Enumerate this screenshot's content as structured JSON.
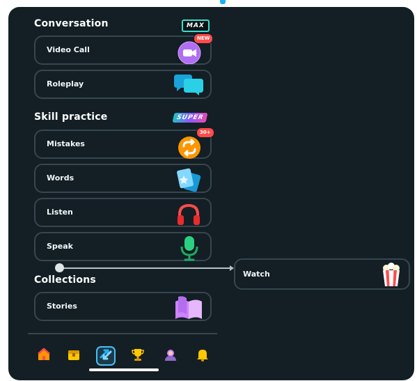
{
  "sections": {
    "conversation": {
      "title": "Conversation",
      "badge": "MAX",
      "items": [
        {
          "label": "Video Call",
          "tag": "NEW",
          "icon": "video-camera-icon"
        },
        {
          "label": "Roleplay",
          "icon": "chat-bubbles-icon"
        }
      ]
    },
    "skill_practice": {
      "title": "Skill practice",
      "badge": "SUPER",
      "items": [
        {
          "label": "Mistakes",
          "tag": "30+",
          "icon": "repeat-arrows-icon"
        },
        {
          "label": "Words",
          "icon": "flashcards-icon"
        },
        {
          "label": "Listen",
          "icon": "headphones-icon"
        },
        {
          "label": "Speak",
          "icon": "microphone-icon"
        }
      ]
    },
    "collections": {
      "title": "Collections",
      "items": [
        {
          "label": "Stories",
          "icon": "open-book-icon"
        }
      ]
    }
  },
  "callout": {
    "label": "Watch",
    "icon": "popcorn-icon"
  },
  "bottom_nav": [
    {
      "icon": "home-icon",
      "active": false
    },
    {
      "icon": "treasure-chest-icon",
      "active": false
    },
    {
      "icon": "practice-arrows-icon",
      "active": true
    },
    {
      "icon": "trophy-icon",
      "active": false
    },
    {
      "icon": "profile-icon",
      "active": false
    },
    {
      "icon": "bell-icon",
      "active": false
    }
  ],
  "colors": {
    "background": "#131f24",
    "card_border": "#37464f",
    "accent": "#1cb0f6",
    "badge_red": "#ff4b4b"
  }
}
